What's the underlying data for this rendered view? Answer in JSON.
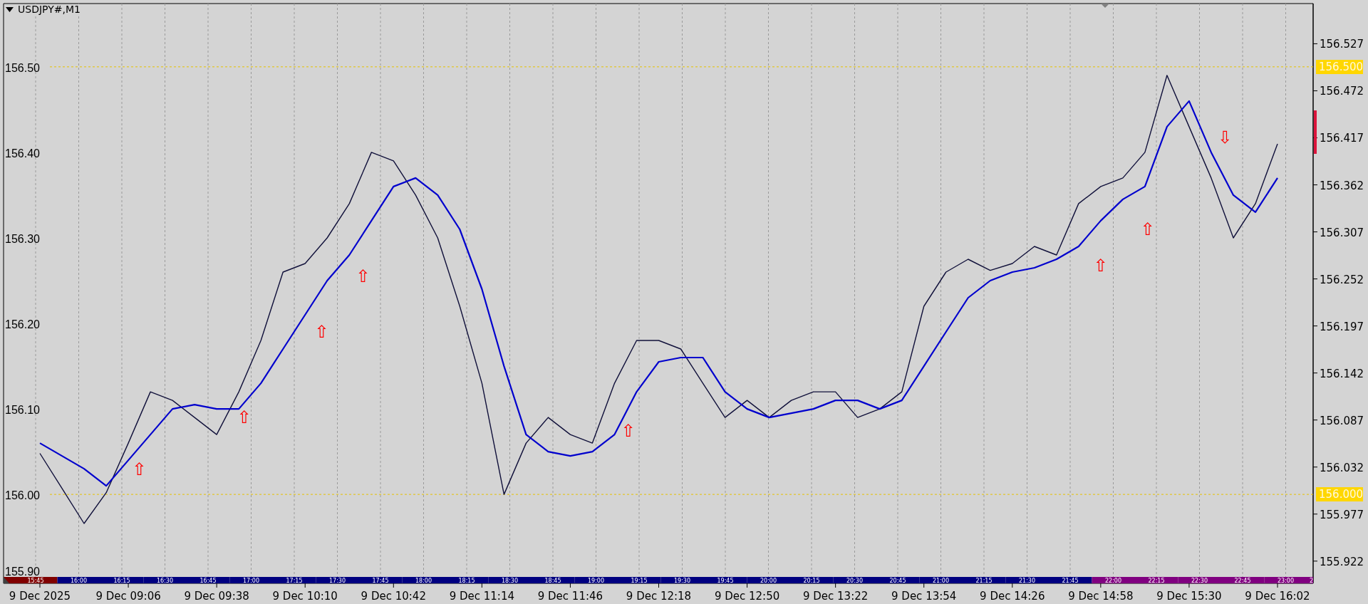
{
  "chart": {
    "chart_data": {
      "type": "line",
      "title": "USDJPY#,M1",
      "categories": [
        "9 Dec 2025",
        null,
        null,
        null,
        "9 Dec 09:06",
        null,
        null,
        null,
        "9 Dec 09:38",
        null,
        null,
        null,
        "9 Dec 10:10",
        null,
        null,
        null,
        "9 Dec 10:42",
        null,
        null,
        null,
        "9 Dec 11:14",
        null,
        null,
        null,
        "9 Dec 11:46",
        null,
        null,
        null,
        "9 Dec 12:18",
        null,
        null,
        null,
        "9 Dec 12:50",
        null,
        null,
        null,
        "9 Dec 13:22",
        null,
        null,
        null,
        "9 Dec 13:54",
        null,
        null,
        null,
        "9 Dec 14:26",
        null,
        null,
        null,
        "9 Dec 14:58",
        null,
        null,
        null,
        "9 Dec 15:30",
        null,
        null,
        null,
        "9 Dec 16:02"
      ],
      "series": [
        {
          "color": "#10103a",
          "values": [
            156.048,
            156.007,
            155.966,
            156.002,
            156.06,
            156.12,
            156.11,
            156.09,
            156.07,
            156.12,
            156.18,
            156.26,
            156.27,
            156.3,
            156.34,
            156.4,
            156.39,
            156.35,
            156.3,
            156.22,
            156.13,
            156.0,
            156.06,
            156.09,
            156.07,
            156.06,
            156.13,
            156.18,
            156.18,
            156.17,
            156.13,
            156.09,
            156.11,
            156.09,
            156.11,
            156.12,
            156.12,
            156.09,
            156.1,
            156.12,
            156.22,
            156.26,
            156.275,
            156.262,
            156.27,
            156.29,
            156.28,
            156.34,
            156.36,
            156.37,
            156.4,
            156.49,
            156.43,
            156.37,
            156.3,
            156.34,
            156.41
          ]
        },
        {
          "color": "#0000cd",
          "values": [
            156.06,
            156.045,
            156.03,
            156.01,
            156.04,
            156.07,
            156.1,
            156.105,
            156.1,
            156.1,
            156.13,
            156.17,
            156.21,
            156.25,
            156.28,
            156.32,
            156.36,
            156.37,
            156.35,
            156.31,
            156.24,
            156.15,
            156.07,
            156.05,
            156.045,
            156.05,
            156.07,
            156.12,
            156.155,
            156.16,
            156.16,
            156.12,
            156.1,
            156.09,
            156.095,
            156.1,
            156.11,
            156.11,
            156.1,
            156.11,
            156.15,
            156.19,
            156.23,
            156.25,
            156.26,
            156.265,
            156.275,
            156.29,
            156.32,
            156.345,
            156.36,
            156.43,
            156.46,
            156.4,
            156.35,
            156.33,
            156.37
          ]
        }
      ],
      "ylim": [
        155.896,
        156.574
      ],
      "grid": true,
      "ref_lines": [
        {
          "axis": "y",
          "value": 156.5,
          "label": "156.500"
        },
        {
          "axis": "y",
          "value": 156.0,
          "label": "156.000"
        }
      ],
      "yticks": [
        {
          "value": 156.527,
          "label": "156.527"
        },
        {
          "value": 156.472,
          "label": "156.472"
        },
        {
          "value": 156.417,
          "label": "156.417"
        },
        {
          "value": 156.362,
          "label": "156.362"
        },
        {
          "value": 156.307,
          "label": "156.307"
        },
        {
          "value": 156.252,
          "label": "156.252"
        },
        {
          "value": 156.197,
          "label": "156.197"
        },
        {
          "value": 156.142,
          "label": "156.142"
        },
        {
          "value": 156.087,
          "label": "156.087"
        },
        {
          "value": 156.032,
          "label": "156.032"
        },
        {
          "value": 155.977,
          "label": "155.977"
        },
        {
          "value": 155.922,
          "label": "155.922"
        }
      ],
      "annotations": [
        "⇧",
        "⇧",
        "⇧",
        "⇧",
        "⇧",
        "⇧",
        "⇧",
        "⇩"
      ]
    },
    "grid_labels": [
      "156.50",
      "156.40",
      "156.30",
      "156.20",
      "156.10",
      "156.00",
      "155.90"
    ],
    "session_bar": {
      "cells": [
        {
          "label": "15:45",
          "color": "#800000"
        },
        {
          "label": "16:00",
          "color": "#000080"
        },
        {
          "label": "16:15",
          "color": "#000080"
        },
        {
          "label": "16:30",
          "color": "#000080"
        },
        {
          "label": "16:45",
          "color": "#000080"
        },
        {
          "label": "17:00",
          "color": "#000080"
        },
        {
          "label": "17:15",
          "color": "#000080"
        },
        {
          "label": "17:30",
          "color": "#000080"
        },
        {
          "label": "17:45",
          "color": "#000080"
        },
        {
          "label": "18:00",
          "color": "#000080"
        },
        {
          "label": "18:15",
          "color": "#000080"
        },
        {
          "label": "18:30",
          "color": "#000080"
        },
        {
          "label": "18:45",
          "color": "#000080"
        },
        {
          "label": "19:00",
          "color": "#000080"
        },
        {
          "label": "19:15",
          "color": "#000080"
        },
        {
          "label": "19:30",
          "color": "#000080"
        },
        {
          "label": "19:45",
          "color": "#000080"
        },
        {
          "label": "20:00",
          "color": "#000080"
        },
        {
          "label": "20:15",
          "color": "#000080"
        },
        {
          "label": "20:30",
          "color": "#000080"
        },
        {
          "label": "20:45",
          "color": "#000080"
        },
        {
          "label": "21:00",
          "color": "#000080"
        },
        {
          "label": "21:15",
          "color": "#000080"
        },
        {
          "label": "21:30",
          "color": "#000080"
        },
        {
          "label": "21:45",
          "color": "#000080"
        },
        {
          "label": "22:00",
          "color": "#800080"
        },
        {
          "label": "22:15",
          "color": "#800080"
        },
        {
          "label": "22:30",
          "color": "#800080"
        },
        {
          "label": "22:45",
          "color": "#800080"
        },
        {
          "label": "23:00",
          "color": "#800080"
        },
        {
          "label": "2",
          "color": "#800080"
        }
      ]
    }
  }
}
